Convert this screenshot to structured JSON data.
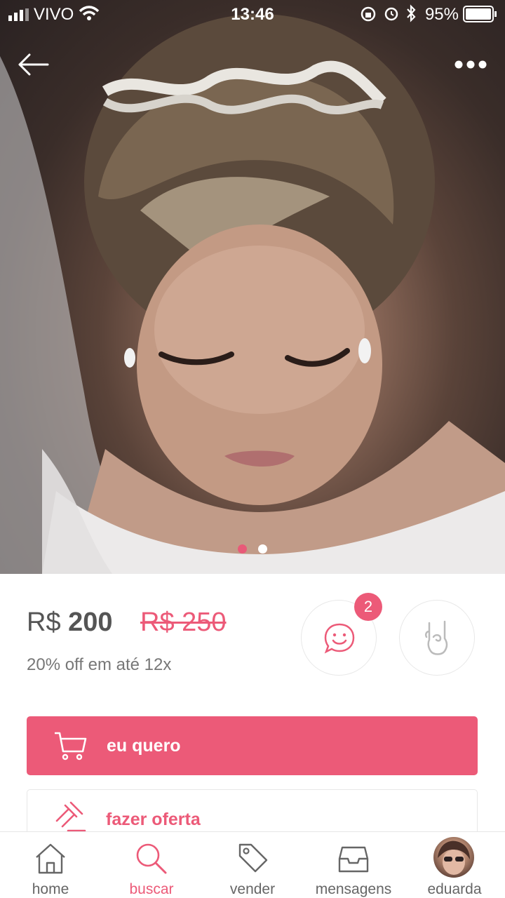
{
  "status_bar": {
    "carrier": "VIVO",
    "time": "13:46",
    "battery": "95%"
  },
  "product": {
    "image_alt": "bridal tiara photo",
    "carousel_pages": 2,
    "carousel_active": 1
  },
  "pricing": {
    "currency": "R$",
    "price": "200",
    "old_price": "R$ 250",
    "installments": "20% off em até 12x"
  },
  "actions": {
    "chat_badge": "2",
    "buy_label": "eu quero",
    "offer_label": "fazer oferta"
  },
  "tabbar": {
    "items": [
      {
        "label": "home",
        "icon": "home-icon"
      },
      {
        "label": "buscar",
        "icon": "search-icon"
      },
      {
        "label": "vender",
        "icon": "tag-icon"
      },
      {
        "label": "mensagens",
        "icon": "inbox-icon"
      },
      {
        "label": "eduarda",
        "icon": "avatar"
      }
    ],
    "active": "buscar"
  },
  "colors": {
    "accent": "#ec5a78",
    "text_dark": "#555555",
    "text_muted": "#777777"
  }
}
